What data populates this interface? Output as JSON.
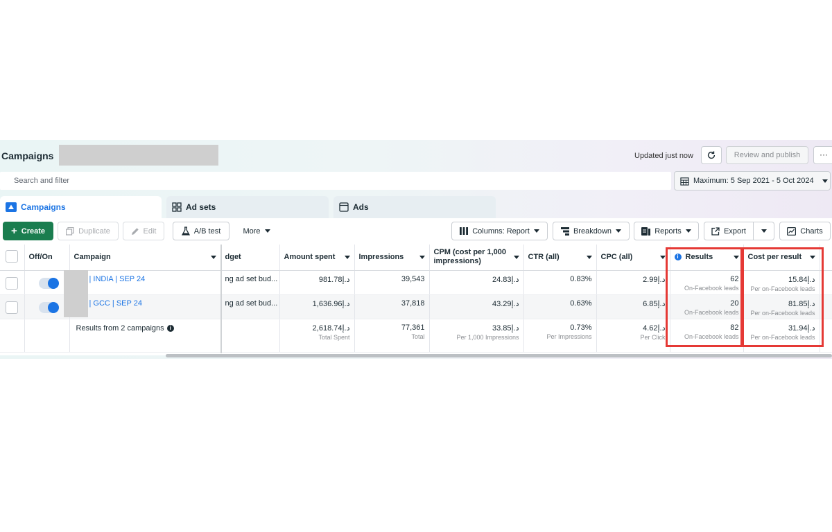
{
  "header": {
    "title": "Campaigns",
    "updated_text": "Updated just now",
    "review_label": "Review and publish",
    "more_label": "···"
  },
  "search": {
    "placeholder": "Search and filter"
  },
  "date_range": {
    "label": "Maximum: 5 Sep 2021 - 5 Oct 2024"
  },
  "tabs": [
    {
      "label": "Campaigns",
      "active": true,
      "icon": "campaign-icon"
    },
    {
      "label": "Ad sets",
      "active": false,
      "icon": "grid-icon"
    },
    {
      "label": "Ads",
      "active": false,
      "icon": "ad-window-icon"
    }
  ],
  "toolbar": {
    "create": "Create",
    "duplicate": "Duplicate",
    "edit": "Edit",
    "ab_test": "A/B test",
    "more": "More",
    "columns": "Columns: Report",
    "breakdown": "Breakdown",
    "reports": "Reports",
    "export": "Export",
    "charts": "Charts"
  },
  "table": {
    "headers": {
      "off_on": "Off/On",
      "campaign": "Campaign",
      "budget": "dget",
      "amount_spent": "Amount spent",
      "impressions": "Impressions",
      "cpm": "CPM (cost per 1,000 impressions)",
      "ctr": "CTR (all)",
      "cpc": "CPC (all)",
      "results": "Results",
      "cost_per_result": "Cost per result"
    },
    "rows": [
      {
        "campaign": "| INDIA | SEP 24",
        "budget": "ng ad set bud...",
        "amount_spent": "د.إ981.78",
        "impressions": "39,543",
        "cpm": "د.إ24.83",
        "ctr": "0.83%",
        "cpc": "د.إ2.99",
        "results": "62",
        "results_sub": "On-Facebook leads",
        "cost_per_result": "د.إ15.84",
        "cost_per_result_sub": "Per on-Facebook leads"
      },
      {
        "campaign": "| GCC | SEP 24",
        "budget": "ng ad set bud...",
        "amount_spent": "د.إ1,636.96",
        "impressions": "37,818",
        "cpm": "د.إ43.29",
        "ctr": "0.63%",
        "cpc": "د.إ6.85",
        "results": "20",
        "results_sub": "On-Facebook leads",
        "cost_per_result": "د.إ81.85",
        "cost_per_result_sub": "Per on-Facebook leads"
      }
    ],
    "summary": {
      "label": "Results from 2 campaigns",
      "amount_spent": "د.إ2,618.74",
      "amount_spent_sub": "Total Spent",
      "impressions": "77,361",
      "impressions_sub": "Total",
      "cpm": "د.إ33.85",
      "cpm_sub": "Per 1,000 Impressions",
      "ctr": "0.73%",
      "ctr_sub": "Per Impressions",
      "cpc": "د.إ4.62",
      "cpc_sub": "Per Click",
      "results": "82",
      "results_sub": "On-Facebook leads",
      "cost_per_result": "د.إ31.94",
      "cost_per_result_sub": "Per on-Facebook leads"
    }
  },
  "colors": {
    "accent": "#1b74e4",
    "create": "#1a7d4f",
    "highlight": "#e53935"
  }
}
